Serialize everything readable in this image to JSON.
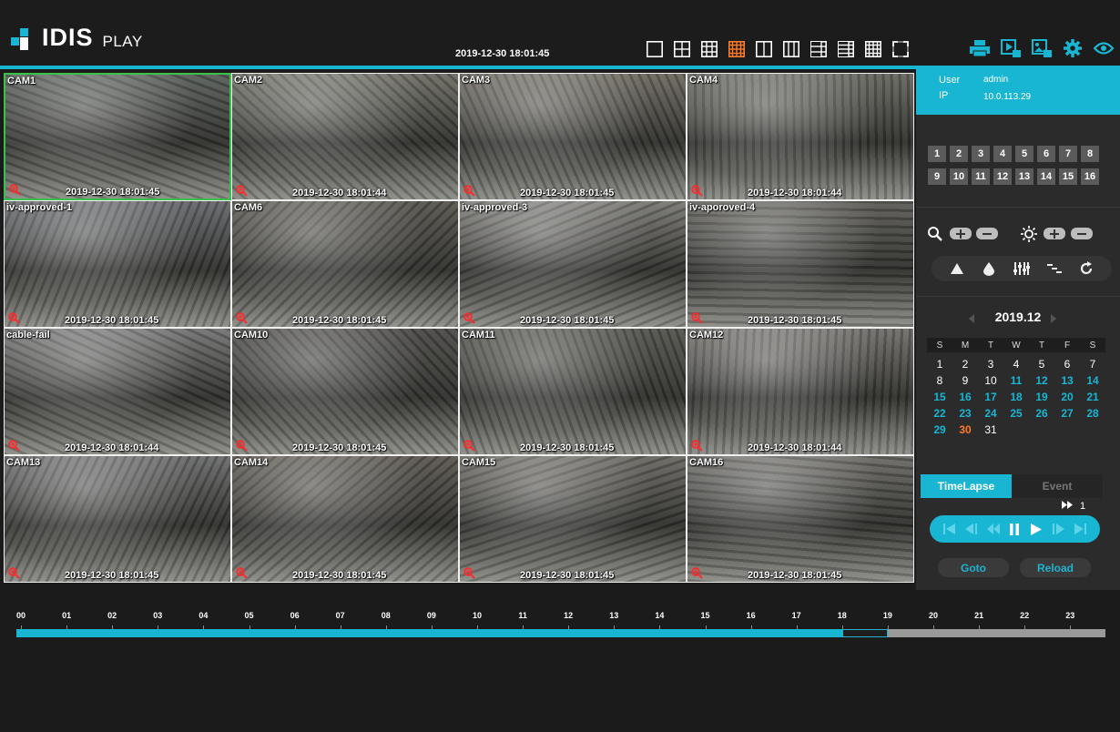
{
  "app": {
    "brand": "IDIS",
    "product": "PLAY"
  },
  "colors": {
    "accent": "#19b6d4",
    "selected": "#38c24b",
    "orange": "#ff7a2a",
    "panel": "#2b2b2b"
  },
  "header": {
    "datetime": "2019-12-30 18:01:45",
    "layouts": [
      {
        "name": "layout-1x1-icon",
        "active": false
      },
      {
        "name": "layout-2x2-icon",
        "active": false
      },
      {
        "name": "layout-3x3-icon",
        "active": false
      },
      {
        "name": "layout-4x4-icon",
        "active": true
      },
      {
        "name": "layout-1plus1-icon",
        "active": false
      },
      {
        "name": "layout-1plus2-icon",
        "active": false
      },
      {
        "name": "layout-1plus5-icon",
        "active": false
      },
      {
        "name": "layout-1plus7-icon",
        "active": false
      },
      {
        "name": "layout-1plus12-icon",
        "active": false
      },
      {
        "name": "fullscreen-icon",
        "active": false
      }
    ],
    "tools": [
      "print-icon",
      "export-clip-icon",
      "snapshot-icon",
      "settings-gear-icon",
      "eye-icon"
    ]
  },
  "cameras": [
    {
      "name": "CAM1",
      "timestamp": "2019-12-30 18:01:45",
      "selected": true,
      "tone": "#5a5f5a"
    },
    {
      "name": "CAM2",
      "timestamp": "2019-12-30 18:01:44",
      "selected": false,
      "tone": "#6f6f66"
    },
    {
      "name": "CAM3",
      "timestamp": "2019-12-30 18:01:45",
      "selected": false,
      "tone": "#6d6a60"
    },
    {
      "name": "CAM4",
      "timestamp": "2019-12-30 18:01:44",
      "selected": false,
      "tone": "#686861"
    },
    {
      "name": "iv-approved-1",
      "timestamp": "2019-12-30 18:01:45",
      "selected": false,
      "tone": "#66686c"
    },
    {
      "name": "CAM6",
      "timestamp": "2019-12-30 18:01:45",
      "selected": false,
      "tone": "#58564f"
    },
    {
      "name": "iv-approved-3",
      "timestamp": "2019-12-30 18:01:45",
      "selected": false,
      "tone": "#7a7975"
    },
    {
      "name": "iv-aporoved-4",
      "timestamp": "2019-12-30 18:01:45",
      "selected": false,
      "tone": "#5d5c57"
    },
    {
      "name": "cable-fail",
      "timestamp": "2019-12-30 18:01:44",
      "selected": false,
      "tone": "#737473"
    },
    {
      "name": "CAM10",
      "timestamp": "2019-12-30 18:01:45",
      "selected": false,
      "tone": "#4c4b48"
    },
    {
      "name": "CAM11",
      "timestamp": "2019-12-30 18:01:45",
      "selected": false,
      "tone": "#55554f"
    },
    {
      "name": "CAM12",
      "timestamp": "2019-12-30 18:01:44",
      "selected": false,
      "tone": "#716f6b"
    },
    {
      "name": "CAM13",
      "timestamp": "2019-12-30 18:01:45",
      "selected": false,
      "tone": "#6a6b6b"
    },
    {
      "name": "CAM14",
      "timestamp": "2019-12-30 18:01:45",
      "selected": false,
      "tone": "#5c5851"
    },
    {
      "name": "CAM15",
      "timestamp": "2019-12-30 18:01:45",
      "selected": false,
      "tone": "#6a6862"
    },
    {
      "name": "CAM16",
      "timestamp": "2019-12-30 18:01:45",
      "selected": false,
      "tone": "#6b6a66"
    }
  ],
  "user": {
    "user_label": "User",
    "user_value": "admin",
    "ip_label": "IP",
    "ip_value": "10.0.113.29"
  },
  "channels": [
    "1",
    "2",
    "3",
    "4",
    "5",
    "6",
    "7",
    "8",
    "9",
    "10",
    "11",
    "12",
    "13",
    "14",
    "15",
    "16"
  ],
  "image_tools": [
    "sharpen-icon",
    "color-drop-icon",
    "equalizer-icon",
    "deinterlace-icon",
    "refresh-icon"
  ],
  "calendar": {
    "title": "2019.12",
    "weekdays": [
      "S",
      "M",
      "T",
      "W",
      "T",
      "F",
      "S"
    ],
    "days": [
      {
        "d": "1",
        "s": "n"
      },
      {
        "d": "2",
        "s": "n"
      },
      {
        "d": "3",
        "s": "n"
      },
      {
        "d": "4",
        "s": "n"
      },
      {
        "d": "5",
        "s": "n"
      },
      {
        "d": "6",
        "s": "n"
      },
      {
        "d": "7",
        "s": "n"
      },
      {
        "d": "8",
        "s": "n"
      },
      {
        "d": "9",
        "s": "n"
      },
      {
        "d": "10",
        "s": "n"
      },
      {
        "d": "11",
        "s": "r"
      },
      {
        "d": "12",
        "s": "r"
      },
      {
        "d": "13",
        "s": "r"
      },
      {
        "d": "14",
        "s": "r"
      },
      {
        "d": "15",
        "s": "r"
      },
      {
        "d": "16",
        "s": "r"
      },
      {
        "d": "17",
        "s": "r"
      },
      {
        "d": "18",
        "s": "r"
      },
      {
        "d": "19",
        "s": "r"
      },
      {
        "d": "20",
        "s": "r"
      },
      {
        "d": "21",
        "s": "r"
      },
      {
        "d": "22",
        "s": "r"
      },
      {
        "d": "23",
        "s": "r"
      },
      {
        "d": "24",
        "s": "r"
      },
      {
        "d": "25",
        "s": "r"
      },
      {
        "d": "26",
        "s": "r"
      },
      {
        "d": "27",
        "s": "r"
      },
      {
        "d": "28",
        "s": "r"
      },
      {
        "d": "29",
        "s": "r"
      },
      {
        "d": "30",
        "s": "t"
      },
      {
        "d": "31",
        "s": "n"
      }
    ]
  },
  "tabs": {
    "timelapse": "TimeLapse",
    "event": "Event"
  },
  "playback": {
    "speed": "1"
  },
  "buttons": {
    "goto": "Goto",
    "reload": "Reload"
  },
  "timeline": {
    "hours": [
      "00",
      "01",
      "02",
      "03",
      "04",
      "05",
      "06",
      "07",
      "08",
      "09",
      "10",
      "11",
      "12",
      "13",
      "14",
      "15",
      "16",
      "17",
      "18",
      "19",
      "20",
      "21",
      "22",
      "23"
    ],
    "recorded_until_hour": 19.0,
    "cursor_start_hour": 18.0,
    "cursor_end_hour": 19.0
  }
}
